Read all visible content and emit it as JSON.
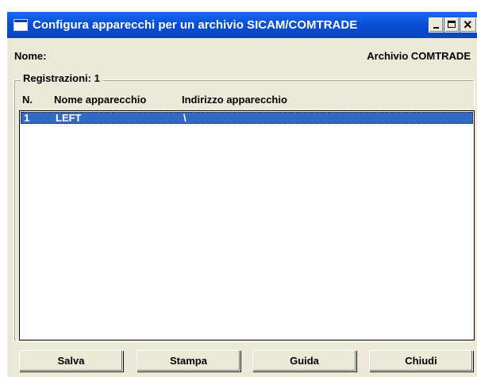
{
  "window": {
    "title": "Configura apparecchi per un archivio SICAM/COMTRADE",
    "name_label": "Nome:",
    "archive_label": "Archivio COMTRADE"
  },
  "group": {
    "legend": "Registrazioni: 1",
    "columns": [
      "N.",
      "Nome apparecchio",
      "Indirizzo apparecchio"
    ]
  },
  "rows": [
    {
      "n": "1",
      "nome": "LEFT",
      "indirizzo": "\\",
      "selected": true
    }
  ],
  "buttons": {
    "salva": "Salva",
    "stampa": "Stampa",
    "guida": "Guida",
    "chiudi": "Chiudi"
  },
  "colors": {
    "titlebar": "#0a4fd6",
    "selection": "#316ac5",
    "dialog_bg": "#ece9d8"
  },
  "icons": [
    "window-icon",
    "minimize-icon",
    "maximize-icon",
    "close-icon"
  ]
}
